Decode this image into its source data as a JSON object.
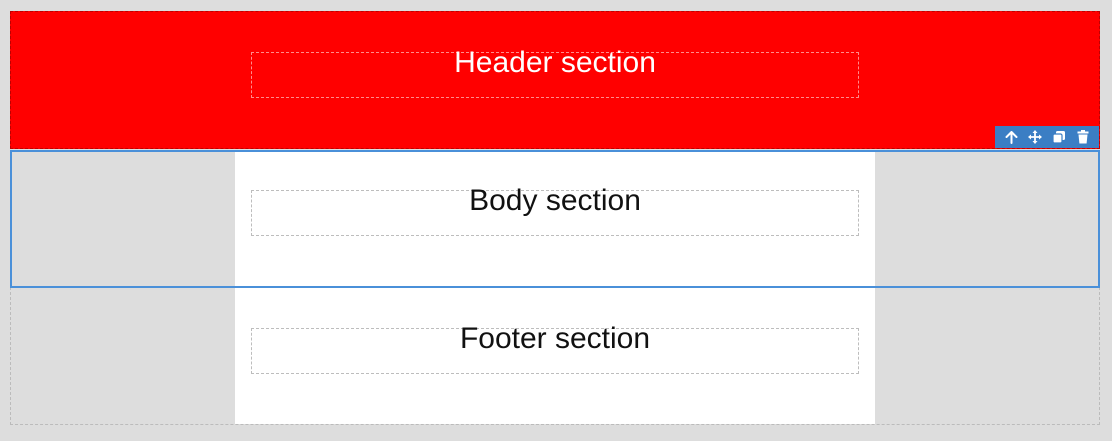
{
  "sections": {
    "header": {
      "label": "Header section",
      "background": "#ff0000"
    },
    "body": {
      "label": "Body section",
      "selected_border_color": "#4a90d9"
    },
    "footer": {
      "label": "Footer section"
    }
  },
  "toolbar": {
    "background": "#3b7ec4",
    "icons": [
      "arrow-up-icon",
      "move-icon",
      "clone-icon",
      "delete-icon"
    ]
  }
}
